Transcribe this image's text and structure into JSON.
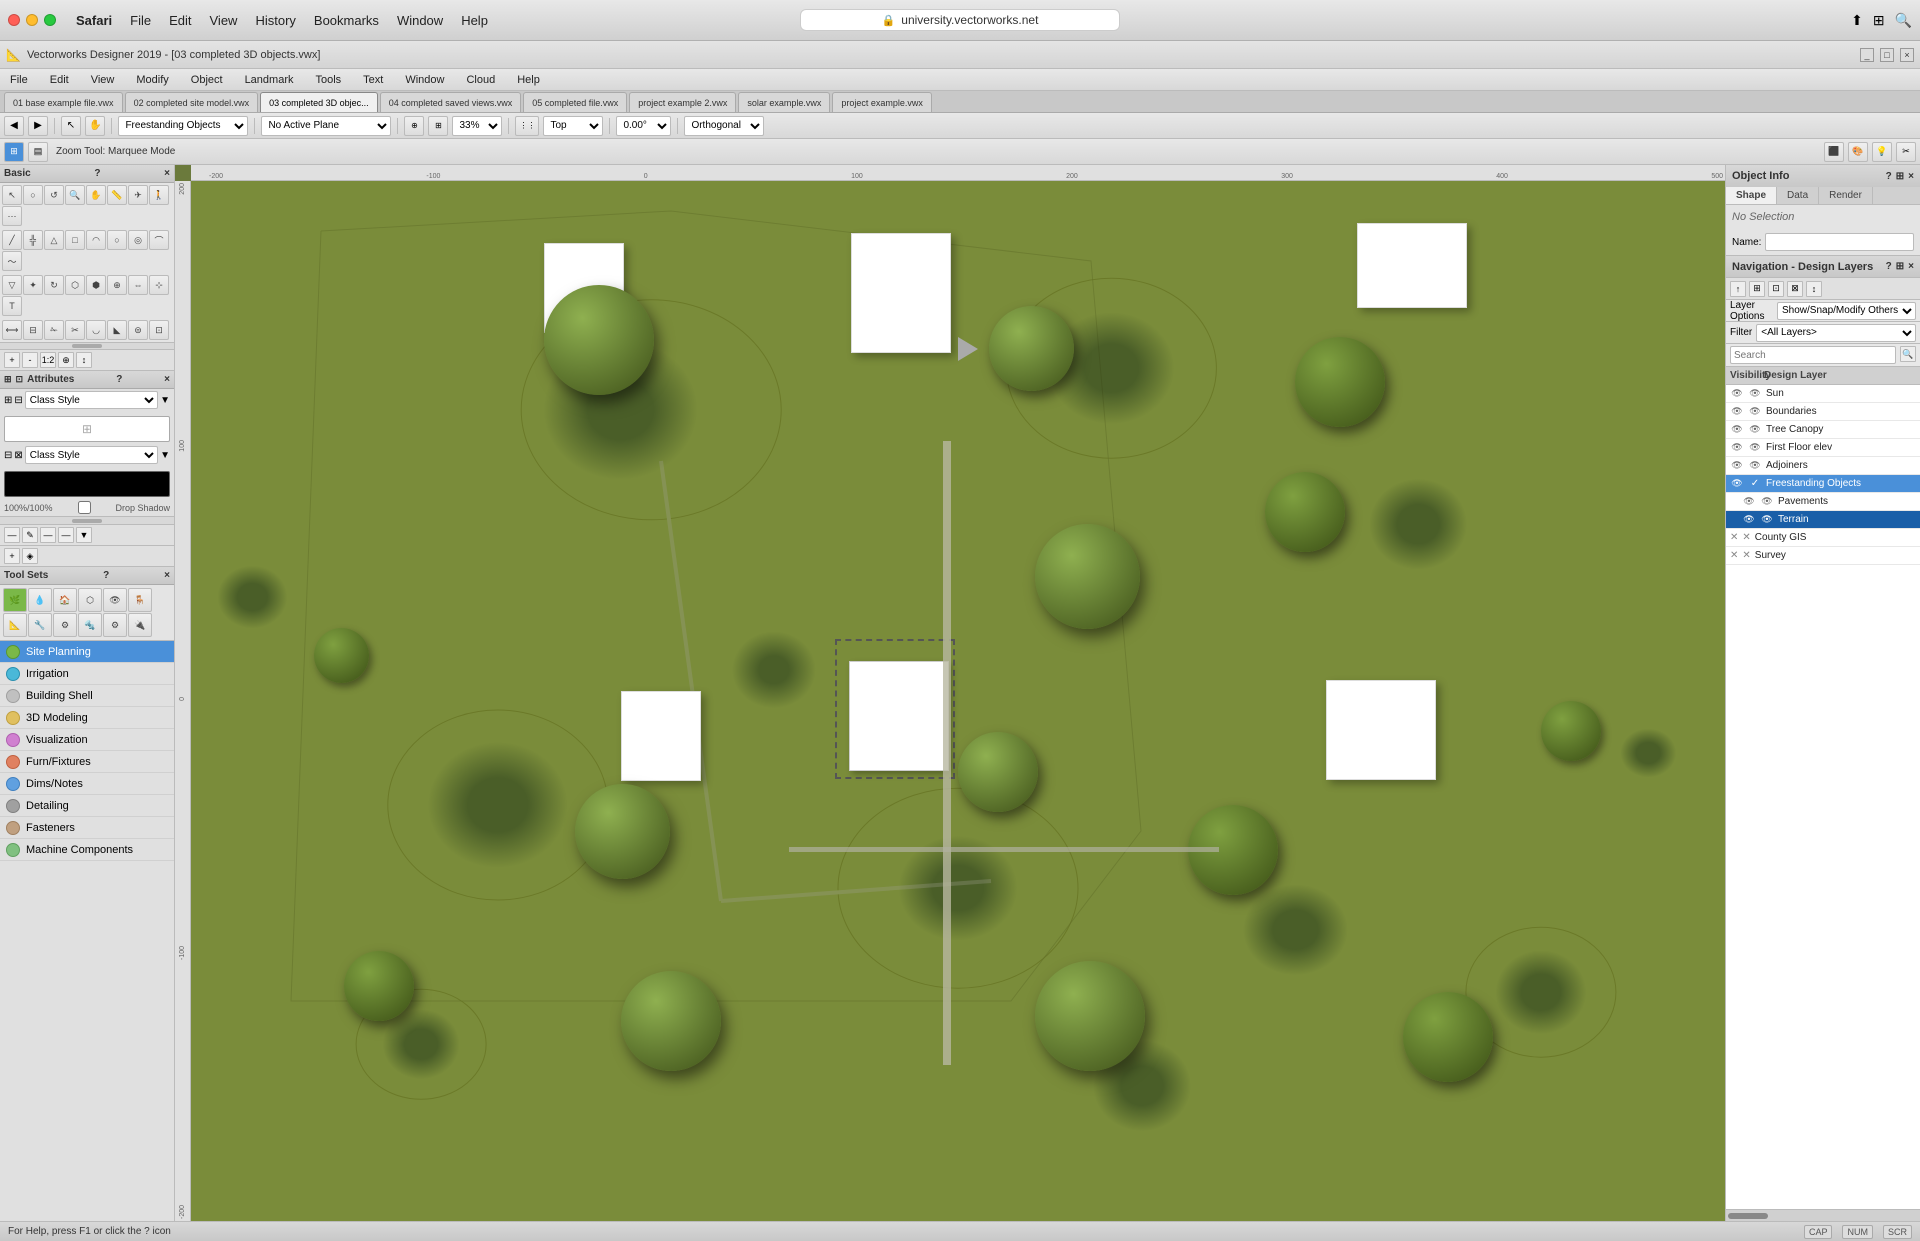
{
  "os": {
    "app": "Safari",
    "menus": [
      "Safari",
      "File",
      "Edit",
      "View",
      "History",
      "Bookmarks",
      "Window",
      "Help"
    ],
    "history_item": "History",
    "address": "university.vectorworks.net",
    "traffic": [
      "close",
      "minimize",
      "maximize"
    ]
  },
  "app": {
    "title": "Vectorworks Designer 2019 - [03 completed 3D objects.vwx]",
    "menus": [
      "File",
      "Edit",
      "View",
      "Modify",
      "Object",
      "Landmark",
      "Tools",
      "Text",
      "Window",
      "Cloud",
      "Help"
    ],
    "window_controls": [
      "minimize",
      "maximize",
      "close"
    ]
  },
  "panel_left": {
    "label": "Basic"
  },
  "tabs": [
    "01 base example file.vwx",
    "02 completed site model.vwx",
    "03 completed 3D objec...",
    "04 completed saved views.vwx",
    "05 completed file.vwx",
    "project example 2.vwx",
    "solar example.vwx",
    "project example.vwx"
  ],
  "active_tab": 2,
  "toolbar1": {
    "zoom_tool_label": "Zoom Tool: Marquee Mode",
    "active_layer": "Freestanding Objects",
    "active_plane": "No Active Plane",
    "zoom": "33%",
    "view": "Top",
    "angle": "0.00°",
    "projection": "Orthogonal"
  },
  "attributes": {
    "title": "Attributes",
    "class_label": "Class Style",
    "fill_label": "Class Style",
    "opacity_label": "100%/100%",
    "drop_shadow_label": "Drop Shadow"
  },
  "toolsets": {
    "title": "Tool Sets",
    "items": [
      {
        "label": "Site Planning",
        "active": true
      },
      {
        "label": "Irrigation",
        "active": false
      },
      {
        "label": "Building Shell",
        "active": false
      },
      {
        "label": "3D Modeling",
        "active": false
      },
      {
        "label": "Visualization",
        "active": false
      },
      {
        "label": "Furn/Fixtures",
        "active": false
      },
      {
        "label": "Dims/Notes",
        "active": false
      },
      {
        "label": "Detailing",
        "active": false
      },
      {
        "label": "Fasteners",
        "active": false
      },
      {
        "label": "Machine Components",
        "active": false
      }
    ]
  },
  "object_info": {
    "title": "Object Info",
    "tabs": [
      "Shape",
      "Data",
      "Render"
    ],
    "no_selection": "No Selection",
    "name_label": "Name:",
    "name_placeholder": ""
  },
  "navigation": {
    "title": "Navigation - Design Layers",
    "layer_options_label": "Layer Options",
    "layer_options_value": "Show/Snap/Modify Others",
    "filter_label": "Filter",
    "filter_value": "<All Layers>",
    "search_placeholder": "Search",
    "col_visibility": "Visibility",
    "col_layer": "Design Layer",
    "layers": [
      {
        "name": "Sun",
        "visible": true,
        "x": false,
        "check": false,
        "indent": 0
      },
      {
        "name": "Boundaries",
        "visible": true,
        "x": false,
        "check": false,
        "indent": 0
      },
      {
        "name": "Tree Canopy",
        "visible": true,
        "x": false,
        "check": false,
        "indent": 0
      },
      {
        "name": "First Floor elev",
        "visible": true,
        "x": false,
        "check": false,
        "indent": 0
      },
      {
        "name": "Adjoiners",
        "visible": true,
        "x": false,
        "check": false,
        "indent": 0
      },
      {
        "name": "Freestanding Objects",
        "visible": true,
        "x": false,
        "check": true,
        "indent": 0,
        "active": true
      },
      {
        "name": "Pavements",
        "visible": true,
        "x": false,
        "check": false,
        "indent": 1
      },
      {
        "name": "Terrain",
        "visible": true,
        "x": false,
        "check": false,
        "indent": 1,
        "selected": true
      },
      {
        "name": "County GIS",
        "visible": false,
        "x": true,
        "check": false,
        "indent": 0
      },
      {
        "name": "Survey",
        "visible": false,
        "x": true,
        "check": false,
        "indent": 0
      }
    ]
  },
  "statusbar": {
    "help_text": "For Help, press F1 or click the ? icon",
    "cap": "CAP",
    "num": "NUM",
    "scroll": "SCR"
  }
}
